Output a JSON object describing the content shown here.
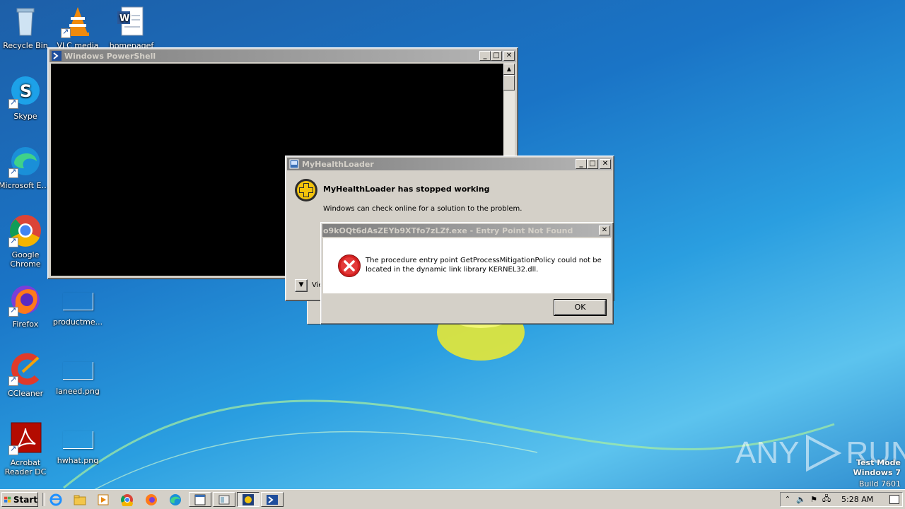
{
  "desktop": {
    "icons": [
      {
        "label": "Recycle Bin"
      },
      {
        "label": "VLC media"
      },
      {
        "label": "homepagef"
      },
      {
        "label": "Skype"
      },
      {
        "label": "Microsoft Edge"
      },
      {
        "label": "Google Chrome"
      },
      {
        "label": "Firefox"
      },
      {
        "label": "productme..."
      },
      {
        "label": "CCleaner"
      },
      {
        "label": "laneed.png"
      },
      {
        "label": "Acrobat Reader DC"
      },
      {
        "label": "hwhat.png"
      }
    ],
    "watermark": {
      "brand": "ANY",
      "brand2": "RUN",
      "mode_line1": "Test Mode",
      "mode_line2": "Windows 7",
      "mode_line3": "Build 7601"
    }
  },
  "powershell": {
    "title": "Windows PowerShell"
  },
  "crash_dialog": {
    "title": "MyHealthLoader",
    "heading": "MyHealthLoader has stopped working",
    "message": "Windows can check online for a solution to the problem.",
    "details_label": "Vie"
  },
  "error_dialog": {
    "title": "o9kOQt6dAsZEYb9XTfo7zLZf.exe - Entry Point Not Found",
    "message_line1": "The procedure entry point GetProcessMitigationPolicy could not be",
    "message_line2": "located in the dynamic link library KERNEL32.dll.",
    "ok_label": "OK"
  },
  "taskbar": {
    "start_label": "Start",
    "clock": "5:28 AM"
  },
  "colors": {
    "title_active": "#0a246a",
    "error_red": "#d32020"
  }
}
